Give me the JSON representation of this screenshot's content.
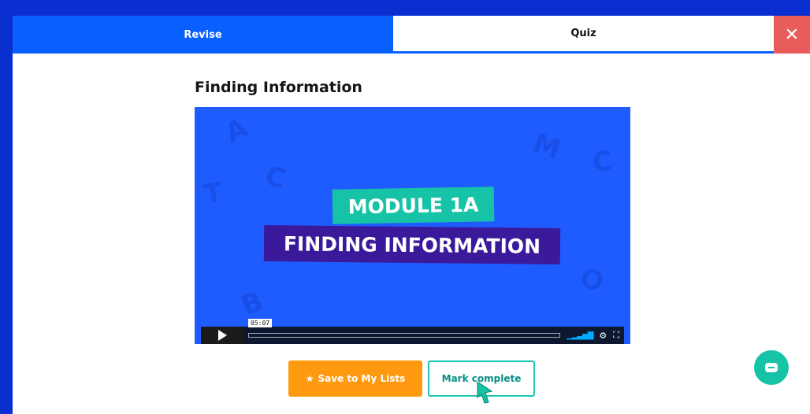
{
  "tabs": {
    "revise": "Revise",
    "quiz": "Quiz",
    "close_icon": "close-icon"
  },
  "lesson": {
    "title": "Finding Information"
  },
  "video": {
    "badge_top": "MODULE 1A",
    "badge_bottom": "FINDING INFORMATION",
    "timestamp": "05:07",
    "icons": [
      "play-icon",
      "volume-icon",
      "settings-icon",
      "fullscreen-icon"
    ]
  },
  "actions": {
    "save_label": "Save to My Lists",
    "mark_label": "Mark complete"
  },
  "colors": {
    "page_bg": "#0a2fd1",
    "tab_active": "#0a60ff",
    "close": "#e85c5c",
    "save": "#ff9a10",
    "teal": "#17c3a6",
    "module_purple": "#3a1a9b"
  }
}
